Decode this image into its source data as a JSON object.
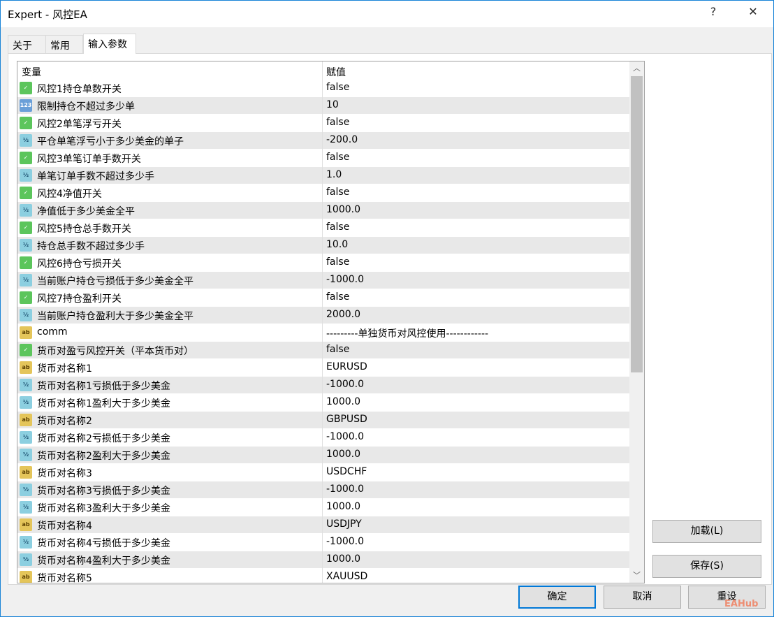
{
  "window": {
    "title": "Expert - 风控EA",
    "help": "?",
    "close": "✕"
  },
  "tabs": [
    "关于",
    "常用",
    "输入参数"
  ],
  "grid": {
    "col_name": "变量",
    "col_value": "赋值",
    "rows": [
      {
        "type": "bool",
        "icon": "bool-icon",
        "name": "风控1持仓单数开关",
        "value": "false"
      },
      {
        "type": "int",
        "icon": "int-icon",
        "name": "限制持仓不超过多少单",
        "value": "10"
      },
      {
        "type": "bool",
        "icon": "bool-icon",
        "name": "风控2单笔浮亏开关",
        "value": "false"
      },
      {
        "type": "dbl",
        "icon": "double-icon",
        "name": "平仓单笔浮亏小于多少美金的单子",
        "value": "-200.0"
      },
      {
        "type": "bool",
        "icon": "bool-icon",
        "name": "风控3单笔订单手数开关",
        "value": "false"
      },
      {
        "type": "dbl",
        "icon": "double-icon",
        "name": "单笔订单手数不超过多少手",
        "value": "1.0"
      },
      {
        "type": "bool",
        "icon": "bool-icon",
        "name": "风控4净值开关",
        "value": "false"
      },
      {
        "type": "dbl",
        "icon": "double-icon",
        "name": "净值低于多少美金全平",
        "value": "1000.0"
      },
      {
        "type": "bool",
        "icon": "bool-icon",
        "name": "风控5持仓总手数开关",
        "value": "false"
      },
      {
        "type": "dbl",
        "icon": "double-icon",
        "name": "持仓总手数不超过多少手",
        "value": "10.0"
      },
      {
        "type": "bool",
        "icon": "bool-icon",
        "name": "风控6持仓亏损开关",
        "value": "false"
      },
      {
        "type": "dbl",
        "icon": "double-icon",
        "name": "当前账户持仓亏损低于多少美金全平",
        "value": "-1000.0"
      },
      {
        "type": "bool",
        "icon": "bool-icon",
        "name": "风控7持仓盈利开关",
        "value": "false"
      },
      {
        "type": "dbl",
        "icon": "double-icon",
        "name": "当前账户持仓盈利大于多少美金全平",
        "value": "2000.0"
      },
      {
        "type": "str",
        "icon": "string-icon",
        "name": "comm",
        "value": "---------单独货币对风控使用------------"
      },
      {
        "type": "bool",
        "icon": "bool-icon",
        "name": "货币对盈亏风控开关（平本货币对）",
        "value": "false"
      },
      {
        "type": "str",
        "icon": "string-icon",
        "name": "货币对名称1",
        "value": "EURUSD"
      },
      {
        "type": "dbl",
        "icon": "double-icon",
        "name": "货币对名称1亏损低于多少美金",
        "value": "-1000.0"
      },
      {
        "type": "dbl",
        "icon": "double-icon",
        "name": "货币对名称1盈利大于多少美金",
        "value": "1000.0"
      },
      {
        "type": "str",
        "icon": "string-icon",
        "name": "货币对名称2",
        "value": "GBPUSD"
      },
      {
        "type": "dbl",
        "icon": "double-icon",
        "name": "货币对名称2亏损低于多少美金",
        "value": "-1000.0"
      },
      {
        "type": "dbl",
        "icon": "double-icon",
        "name": "货币对名称2盈利大于多少美金",
        "value": "1000.0"
      },
      {
        "type": "str",
        "icon": "string-icon",
        "name": "货币对名称3",
        "value": "USDCHF"
      },
      {
        "type": "dbl",
        "icon": "double-icon",
        "name": "货币对名称3亏损低于多少美金",
        "value": "-1000.0"
      },
      {
        "type": "dbl",
        "icon": "double-icon",
        "name": "货币对名称3盈利大于多少美金",
        "value": "1000.0"
      },
      {
        "type": "str",
        "icon": "string-icon",
        "name": "货币对名称4",
        "value": "USDJPY"
      },
      {
        "type": "dbl",
        "icon": "double-icon",
        "name": "货币对名称4亏损低于多少美金",
        "value": "-1000.0"
      },
      {
        "type": "dbl",
        "icon": "double-icon",
        "name": "货币对名称4盈利大于多少美金",
        "value": "1000.0"
      },
      {
        "type": "str",
        "icon": "string-icon",
        "name": "货币对名称5",
        "value": "XAUUSD"
      }
    ]
  },
  "icon_glyphs": {
    "bool": "✓",
    "int": "123",
    "dbl": "½",
    "str": "ab"
  },
  "buttons": {
    "load": "加载(L)",
    "save": "保存(S)",
    "ok": "确定",
    "cancel": "取消",
    "reset": "重设"
  },
  "watermark": "EAHub"
}
